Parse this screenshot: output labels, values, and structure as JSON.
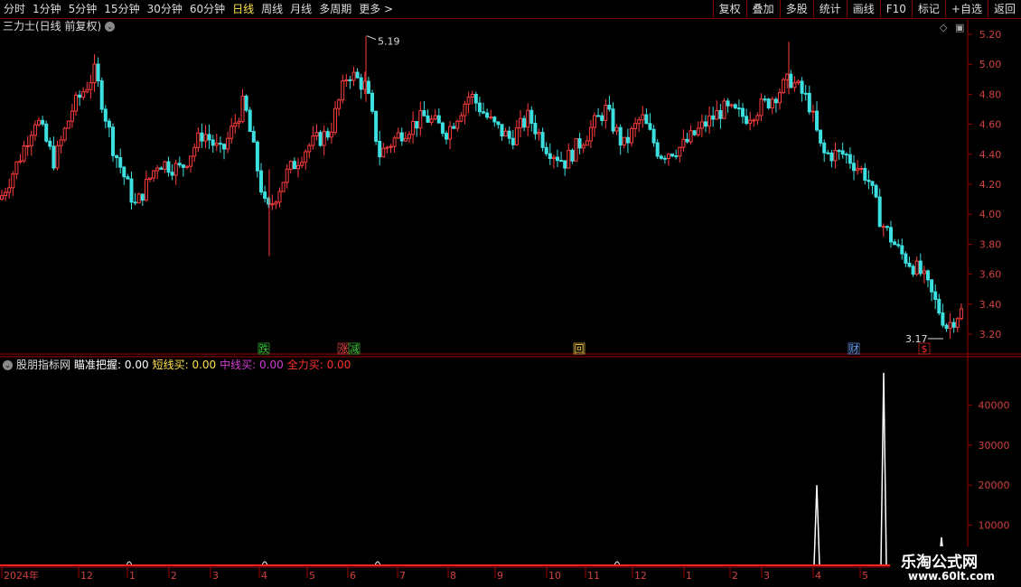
{
  "toolbar": {
    "periods": [
      "分时",
      "1分钟",
      "5分钟",
      "15分钟",
      "30分钟",
      "60分钟",
      "日线",
      "周线",
      "月线",
      "多周期",
      "更多 >"
    ],
    "active_period": "日线",
    "right_buttons": [
      "复权",
      "叠加",
      "多股",
      "统计",
      "画线",
      "F10",
      "标记",
      "+自选",
      "返回"
    ]
  },
  "main_panel": {
    "title": "三力士(日线 前复权)",
    "high_marker": "5.19",
    "low_marker": "3.17",
    "y_axis_labels": [
      "5.20",
      "5.00",
      "4.80",
      "4.60",
      "4.40",
      "4.20",
      "4.00",
      "3.80",
      "3.60",
      "3.40",
      "3.20"
    ],
    "event_markers": [
      {
        "text": "跌",
        "color": "#3ccf3c"
      },
      {
        "text": "涨",
        "color": "#ff4a4a"
      },
      {
        "text": "减",
        "color": "#3ccf3c"
      },
      {
        "text": "回",
        "color": "#ffd24a"
      },
      {
        "text": "财",
        "color": "#6fa8ff"
      },
      {
        "text": "$",
        "color": "#ff3030"
      }
    ]
  },
  "indicator_panel": {
    "name": "股朋指标网",
    "items": [
      {
        "label": "瞄准把握:",
        "value": "0.00",
        "color": "#ffffff"
      },
      {
        "label": "短线买:",
        "value": "0.00",
        "color": "#ffe24a"
      },
      {
        "label": "中线买:",
        "value": "0.00",
        "color": "#d23cd2"
      },
      {
        "label": "全力买:",
        "value": "0.00",
        "color": "#ff3030"
      }
    ],
    "y_axis_labels": [
      "40000",
      "30000",
      "20000",
      "10000"
    ]
  },
  "x_axis_labels": [
    "2024年",
    "12",
    "1",
    "2",
    "3",
    "4",
    "5",
    "6",
    "7",
    "8",
    "9",
    "10",
    "11",
    "12",
    "1",
    "2",
    "3",
    "4",
    "5"
  ],
  "watermark": {
    "line1": "乐淘公式网",
    "line2": "www.60lt.com"
  },
  "chart_data": {
    "type": "candlestick",
    "title": "三力士(日线 前复权)",
    "ylim": [
      3.1,
      5.25
    ],
    "annotated_high": 5.19,
    "annotated_low": 3.17,
    "indicator": {
      "name": "股朋指标网",
      "ylim": [
        0,
        50000
      ],
      "spikes": [
        {
          "label": "4",
          "value": 20000
        },
        {
          "label": "5",
          "value": 48000
        },
        {
          "label": "5",
          "value": 7000
        }
      ]
    }
  }
}
